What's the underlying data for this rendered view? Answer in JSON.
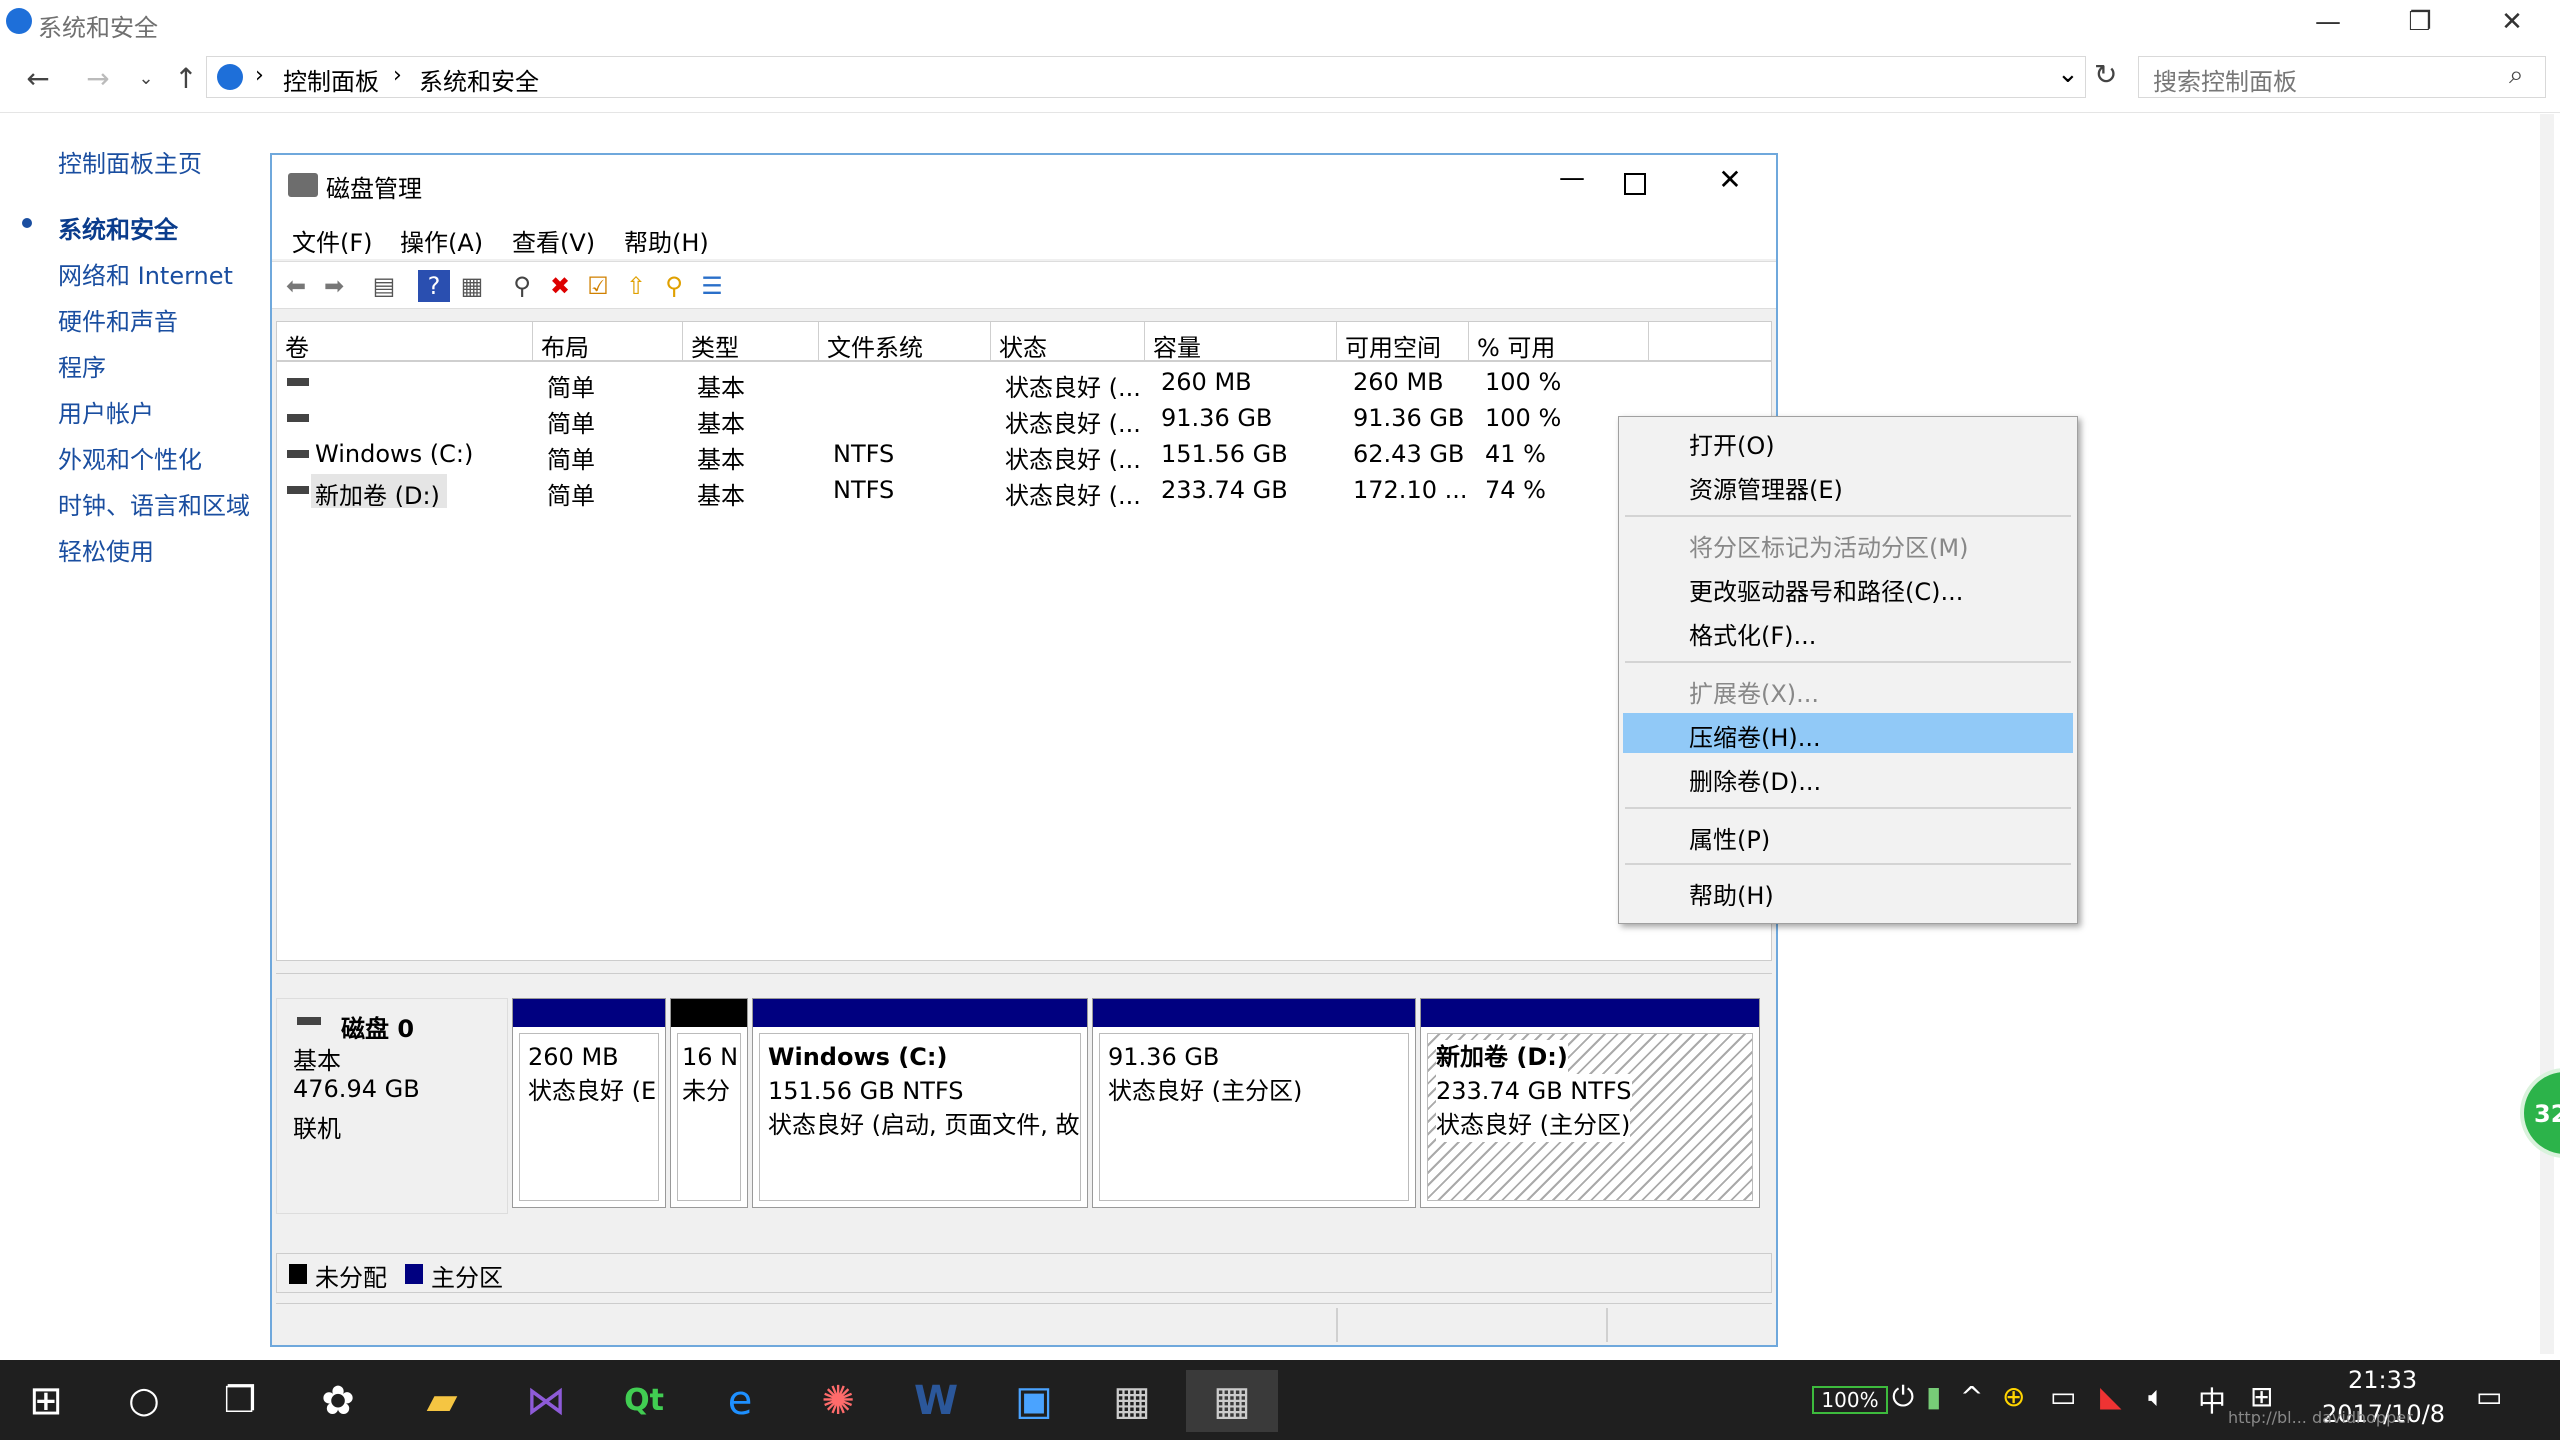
{
  "explorer": {
    "title": "系统和安全",
    "breadcrumb": [
      "控制面板",
      "系统和安全"
    ],
    "search_placeholder": "搜索控制面板",
    "controls": {
      "minimize": "—",
      "restore": "❐",
      "close": "✕"
    }
  },
  "sidebar": {
    "items": [
      "控制面板主页",
      "系统和安全",
      "网络和 Internet",
      "硬件和声音",
      "程序",
      "用户帐户",
      "外观和个性化",
      "时钟、语言和区域",
      "轻松使用"
    ],
    "active_index": 1
  },
  "disk_mgmt": {
    "title": "磁盘管理",
    "menu": [
      "文件(F)",
      "操作(A)",
      "查看(V)",
      "帮助(H)"
    ],
    "columns": [
      "卷",
      "布局",
      "类型",
      "文件系统",
      "状态",
      "容量",
      "可用空间",
      "% 可用"
    ],
    "rows": [
      {
        "vol": "",
        "layout": "简单",
        "type": "基本",
        "fs": "",
        "status": "状态良好 (...",
        "capacity": "260 MB",
        "free": "260 MB",
        "pct": "100 %"
      },
      {
        "vol": "",
        "layout": "简单",
        "type": "基本",
        "fs": "",
        "status": "状态良好 (...",
        "capacity": "91.36 GB",
        "free": "91.36 GB",
        "pct": "100 %"
      },
      {
        "vol": "Windows (C:)",
        "layout": "简单",
        "type": "基本",
        "fs": "NTFS",
        "status": "状态良好 (...",
        "capacity": "151.56 GB",
        "free": "62.43 GB",
        "pct": "41 %"
      },
      {
        "vol": "新加卷 (D:)",
        "layout": "简单",
        "type": "基本",
        "fs": "NTFS",
        "status": "状态良好 (...",
        "capacity": "233.74 GB",
        "free": "172.10 ...",
        "pct": "74 %"
      }
    ],
    "disk": {
      "name": "磁盘 0",
      "type": "基本",
      "size": "476.94 GB",
      "state": "联机"
    },
    "partitions": [
      {
        "name": "",
        "size": "260 MB",
        "status": "状态良好 (E"
      },
      {
        "name": "",
        "size": "16 N",
        "status": "未分"
      },
      {
        "name": "Windows  (C:)",
        "size": "151.56 GB NTFS",
        "status": "状态良好 (启动, 页面文件, 故"
      },
      {
        "name": "",
        "size": "91.36 GB",
        "status": "状态良好 (主分区)"
      },
      {
        "name": "新加卷  (D:)",
        "size": "233.74 GB NTFS",
        "status": "状态良好 (主分区)"
      }
    ],
    "legend": [
      "未分配",
      "主分区"
    ]
  },
  "context_menu": {
    "items": [
      {
        "label": "打开(O)",
        "disabled": false
      },
      {
        "label": "资源管理器(E)",
        "disabled": false
      },
      {
        "label": "将分区标记为活动分区(M)",
        "disabled": true
      },
      {
        "label": "更改驱动器号和路径(C)...",
        "disabled": false
      },
      {
        "label": "格式化(F)...",
        "disabled": false
      },
      {
        "label": "扩展卷(X)...",
        "disabled": true
      },
      {
        "label": "压缩卷(H)...",
        "disabled": false,
        "highlighted": true
      },
      {
        "label": "删除卷(D)...",
        "disabled": false
      },
      {
        "label": "属性(P)",
        "disabled": false
      },
      {
        "label": "帮助(H)",
        "disabled": false
      }
    ]
  },
  "taskbar": {
    "battery": "100%",
    "ime": "中",
    "time": "21:33",
    "date": "2017/10/8",
    "badge": "32",
    "watermark": "http://bl... davidhopper"
  },
  "colors": {
    "primary_partition": "#000080",
    "unallocated": "#000000",
    "highlight": "#91c9f7",
    "link": "#1a4ea0"
  }
}
